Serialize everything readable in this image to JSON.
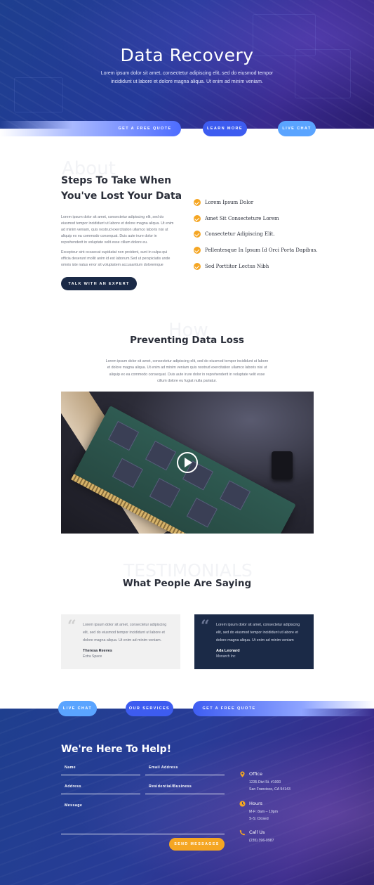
{
  "hero": {
    "title": "Data Recovery",
    "subtitle": "Lorem ipsum dolor sit amet, consectetur adipiscing elit, sed do eiusmod tempor incididunt ut labore et dolore magna aliqua. Ut enim ad minim veniam."
  },
  "hero_buttons": {
    "quote": "GET A FREE QUOTE",
    "learn": "LEARN MORE",
    "chat": "LIVE CHAT"
  },
  "about": {
    "ghost": "About",
    "title": "Steps To Take When You've Lost Your Data",
    "paragraph1": "Lorem ipsum dolor sit amet, consectetur adipiscing elit, sed do eiusmod tempor incididunt ut labore et dolore magna aliqua. Ut enim ad minim veniam, quis nostrud exercitation ullamco laboris nisi ut aliquip ex ea commodo consequat. Duis aute irure dolor in reprehenderit in voluptate velit esse cillum dolore eu.",
    "paragraph2": "Excepteur sint occaecat cupidatat non proident, sunt in culpa qui officia deserunt mollit anim id est laborum.Sed ut perspiciatis unde omnis iste natus error sit voluptatem accusantium doloremque",
    "button": "TALK WITH AN EXPERT",
    "checklist": [
      "Lorem Ipsum Dolor",
      "Amet Sit Consecteture Lorem",
      "Consectetur Adipiscing Elit.",
      "Pellentesque In Ipsum Id Orci Porta Dapibus.",
      "Sed Porttitor Lectus Nibh"
    ]
  },
  "prevention": {
    "ghost": "How",
    "title": "Preventing Data Loss",
    "text": "Lorem ipsum dolor sit amet, consectetur adipiscing elit, sed do eiusmod tempor incididunt ut labore et dolore magna aliqua. Ut enim ad minim veniam quis nostrud exercitation ullamco laboris nisi ut aliquip ex ea commodo consequat. Duis aute irure dolor in reprehenderit in voluptate velit esse cillum dolore eu fugiat nulla pariatur."
  },
  "testimonials": {
    "ghost": "TESTIMONIALS",
    "title": "What People Are Saying",
    "items": [
      {
        "text": "Lorem ipsum dolor sit amet, consectetur adipiscing elit, sed do eiusmod tempor incididunt ut labore et dolore magna aliqua. Ut enim ad minim veniam.",
        "name": "Theresa Reeves",
        "org": "Extra Space"
      },
      {
        "text": "Lorem ipsum dolor sit amet, consectetur adipiscing elit, sed do eiusmod tempor incididunt ut labore et dolore magna aliqua. Ut enim ad minim veniam",
        "name": "Ada Leonard",
        "org": "Monarch Inc"
      }
    ]
  },
  "footer_buttons": {
    "chat": "LIVE CHAT",
    "services": "OUR SERVICES",
    "quote": "GET A FREE QUOTE"
  },
  "contact": {
    "title": "We're Here To Help!",
    "fields": {
      "name": "Name",
      "email": "Email Address",
      "address": "Address",
      "residential": "Residential/Business",
      "message": "Message"
    },
    "submit": "SEND MESSAGES",
    "office": {
      "head": "Office",
      "body": "1235 Divi St. #1000\nSan Francisco, CA 94143"
    },
    "hours": {
      "head": "Hours",
      "body": "M-F: 8am – 10pm\nS-S: Closed"
    },
    "call": {
      "head": "Call Us",
      "body": "(235) 396-0987"
    }
  },
  "colors": {
    "accent_orange": "#f5a623",
    "navy": "#1b2a47",
    "blue": "#3f5ef2",
    "light_blue": "#55a7ff"
  },
  "icons": {
    "check": "check-circle-icon",
    "play": "play-icon",
    "quote": "quote-icon",
    "office": "map-pin-icon",
    "hours": "clock-icon",
    "call": "phone-icon"
  }
}
